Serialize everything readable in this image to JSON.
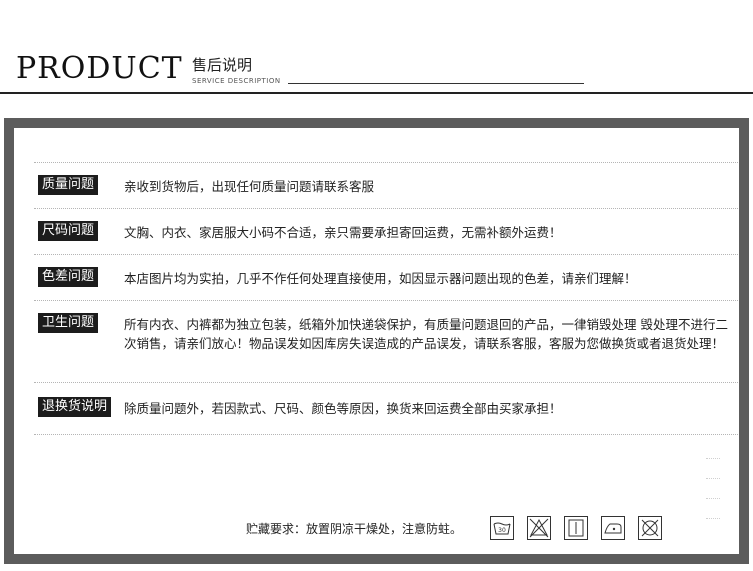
{
  "header": {
    "brand": "PRODUCT",
    "title_cn": "售后说明",
    "subtitle_en": "SERVICE DESCRIPTION"
  },
  "sections": [
    {
      "tag": "质量问题",
      "text": "亲收到货物后，出现任何质量问题请联系客服"
    },
    {
      "tag": "尺码问题",
      "text": "文胸、内衣、家居服大小码不合适，亲只需要承担寄回运费，无需补额外运费！"
    },
    {
      "tag": "色差问题",
      "text": "本店图片均为实拍，几乎不作任何处理直接使用，如因显示器问题出现的色差，请亲们理解！"
    },
    {
      "tag": "卫生问题",
      "text": "所有内衣、内裤都为独立包装，纸箱外加快递袋保护，有质量问题退回的产品，一律销毁处理 毁处理不进行二次销售，请亲们放心！物品误发如因库房失误造成的产品误发，请联系客服，客服为您做换货或者退货处理！"
    },
    {
      "tag": "退换货说明",
      "text": "除质量问题外，若因款式、尺码、颜色等原因，换货来回运费全部由买家承担！"
    }
  ],
  "storage": {
    "text": "贮藏要求：放置阴凉干燥处，注意防蛀。",
    "care_icons": [
      "wash-30-icon",
      "do-not-bleach-icon",
      "hang-dry-icon",
      "iron-low-icon",
      "do-not-dryclean-icon"
    ],
    "wash_temp": "30"
  }
}
